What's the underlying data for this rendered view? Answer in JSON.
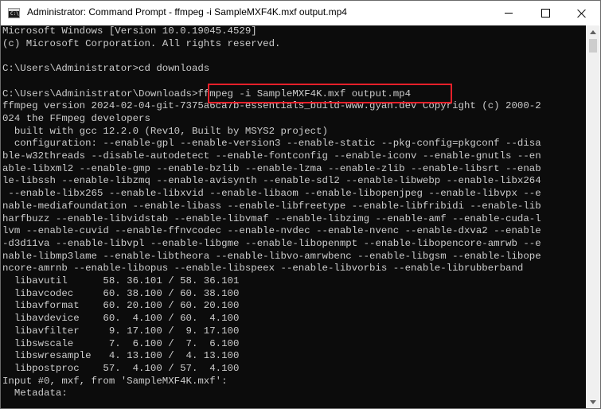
{
  "window": {
    "title": "Administrator: Command Prompt - ffmpeg  -i SampleMXF4K.mxf output.mp4",
    "icon": "cmd-prompt-icon",
    "icon_glyph": "C:\\",
    "controls": {
      "minimize": "minimize-icon",
      "maximize": "maximize-icon",
      "close": "close-icon"
    }
  },
  "console": {
    "text_color": "#cccccc",
    "background": "#0c0c0c",
    "lines": [
      "Microsoft Windows [Version 10.0.19045.4529]",
      "(c) Microsoft Corporation. All rights reserved.",
      "",
      "C:\\Users\\Administrator>cd downloads",
      "",
      "C:\\Users\\Administrator\\Downloads>ffmpeg -i SampleMXF4K.mxf output.mp4",
      "ffmpeg version 2024-02-04-git-7375a6ca7b-essentials_build-www.gyan.dev Copyright (c) 2000-2",
      "024 the FFmpeg developers",
      "  built with gcc 12.2.0 (Rev10, Built by MSYS2 project)",
      "  configuration: --enable-gpl --enable-version3 --enable-static --pkg-config=pkgconf --disa",
      "ble-w32threads --disable-autodetect --enable-fontconfig --enable-iconv --enable-gnutls --en",
      "able-libxml2 --enable-gmp --enable-bzlib --enable-lzma --enable-zlib --enable-libsrt --enab",
      "le-libssh --enable-libzmq --enable-avisynth --enable-sdl2 --enable-libwebp --enable-libx264",
      " --enable-libx265 --enable-libxvid --enable-libaom --enable-libopenjpeg --enable-libvpx --e",
      "nable-mediafoundation --enable-libass --enable-libfreetype --enable-libfribidi --enable-lib",
      "harfbuzz --enable-libvidstab --enable-libvmaf --enable-libzimg --enable-amf --enable-cuda-l",
      "lvm --enable-cuvid --enable-ffnvcodec --enable-nvdec --enable-nvenc --enable-dxva2 --enable",
      "-d3d11va --enable-libvpl --enable-libgme --enable-libopenmpt --enable-libopencore-amrwb --e",
      "nable-libmp3lame --enable-libtheora --enable-libvo-amrwbenc --enable-libgsm --enable-libope",
      "ncore-amrnb --enable-libopus --enable-libspeex --enable-libvorbis --enable-librubberband",
      "  libavutil      58. 36.101 / 58. 36.101",
      "  libavcodec     60. 38.100 / 60. 38.100",
      "  libavformat    60. 20.100 / 60. 20.100",
      "  libavdevice    60.  4.100 / 60.  4.100",
      "  libavfilter     9. 17.100 /  9. 17.100",
      "  libswscale      7.  6.100 /  7.  6.100",
      "  libswresample   4. 13.100 /  4. 13.100",
      "  libpostproc    57.  4.100 / 57.  4.100",
      "Input #0, mxf, from 'SampleMXF4K.mxf':",
      "  Metadata:"
    ]
  },
  "highlight": {
    "text": "ffmpeg -i SampleMXF4K.mxf output.mp4",
    "color": "#e5202a"
  },
  "scrollbar": {
    "up": "scroll-up-arrow-icon",
    "down": "scroll-down-arrow-icon"
  }
}
